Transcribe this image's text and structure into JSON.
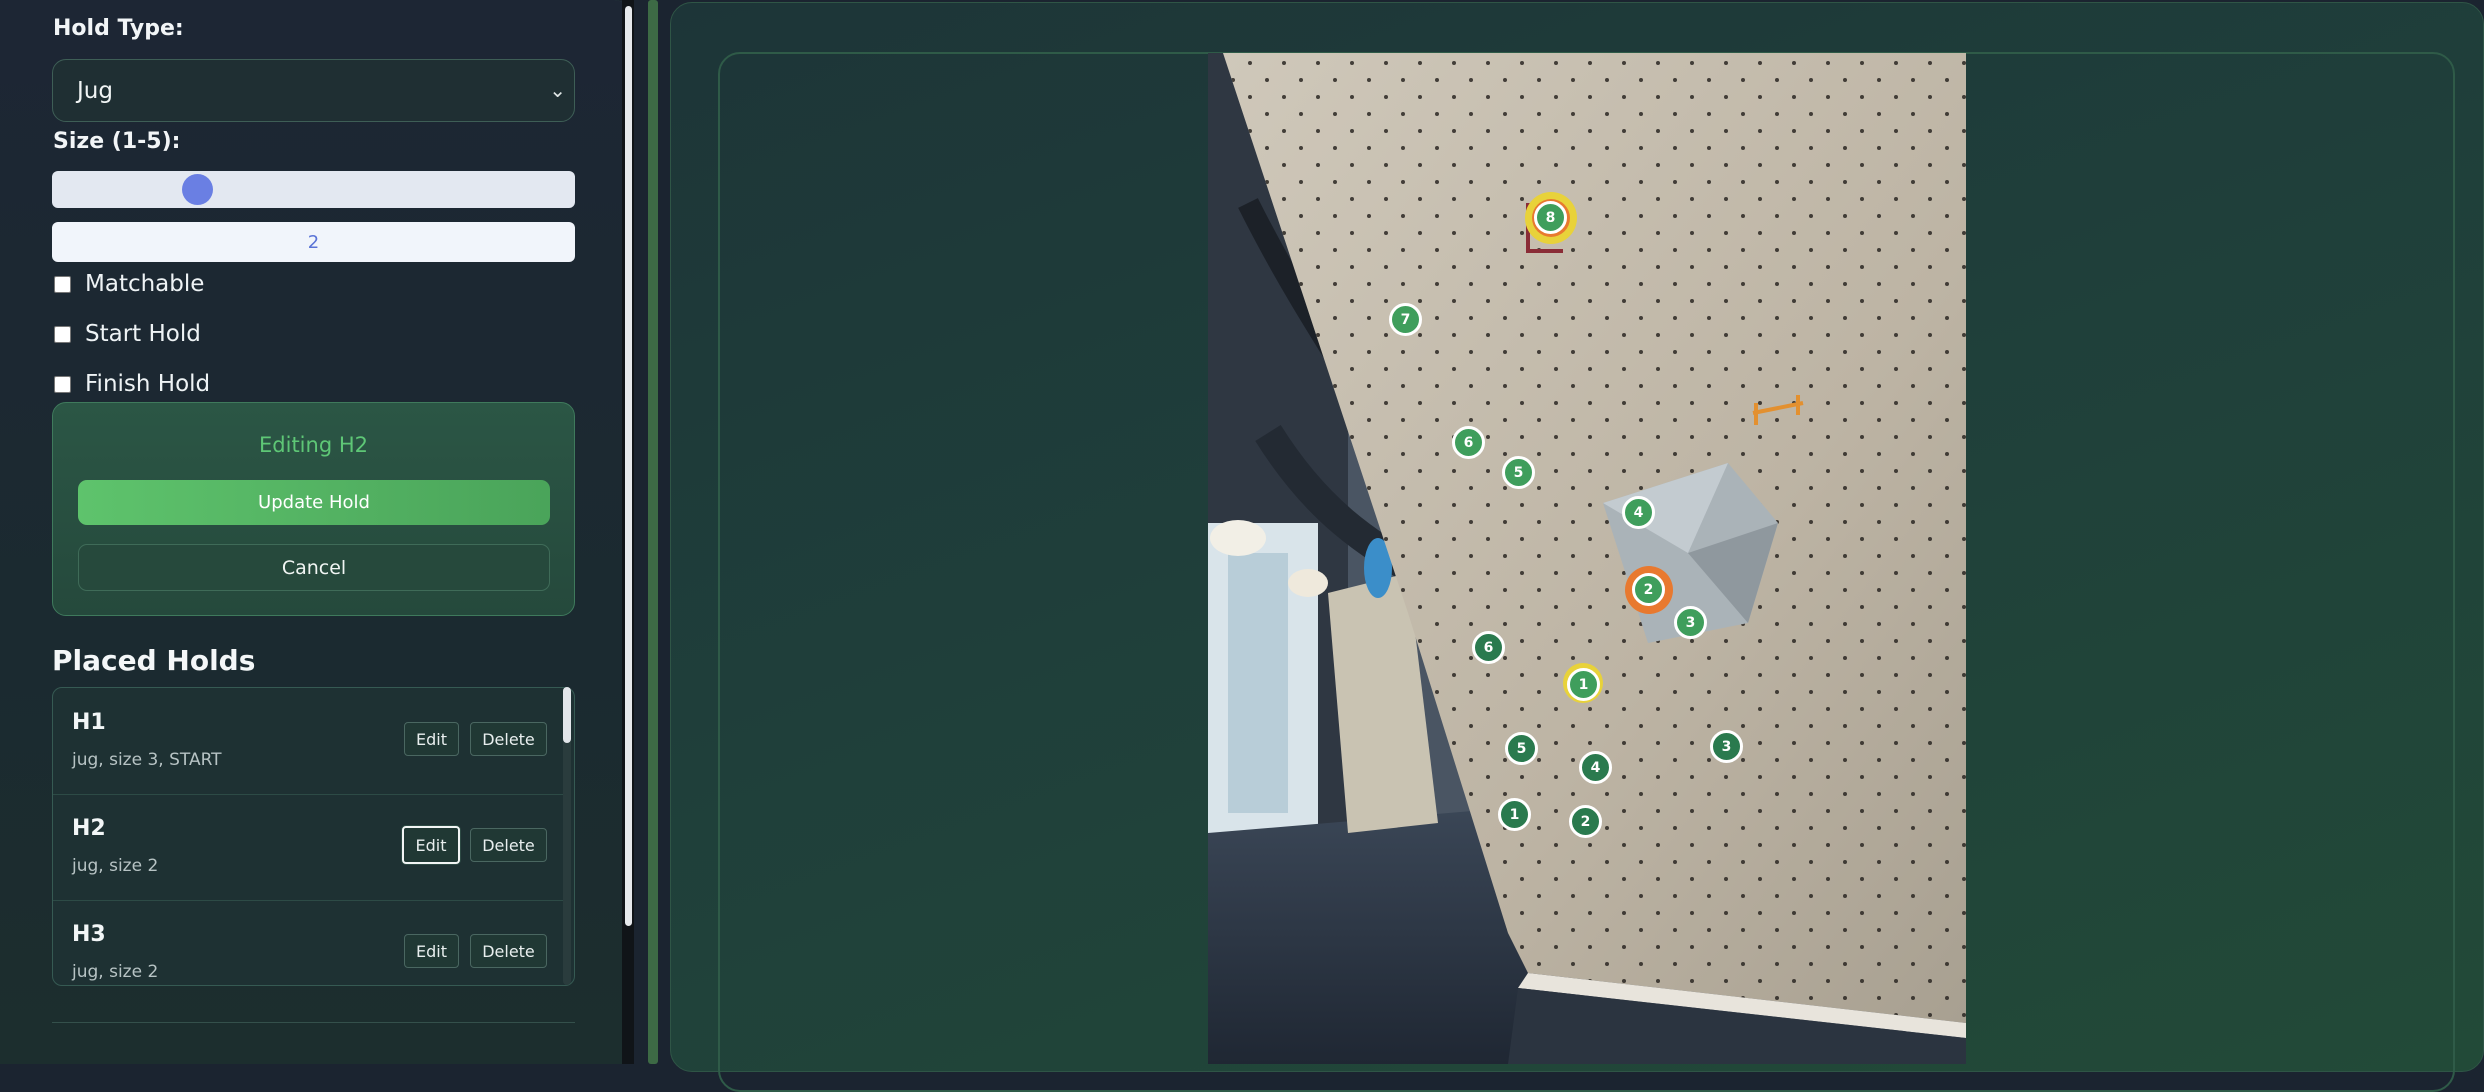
{
  "sidebar": {
    "hold_type_label": "Hold Type:",
    "hold_type_value": "Jug",
    "size_label": "Size (1-5):",
    "size_value": "2",
    "size_level": 2,
    "checkboxes": [
      {
        "label": "Matchable",
        "checked": false
      },
      {
        "label": "Start Hold",
        "checked": false
      },
      {
        "label": "Finish Hold",
        "checked": false
      }
    ],
    "edit_panel": {
      "title": "Editing H2",
      "update_label": "Update Hold",
      "cancel_label": "Cancel"
    },
    "placed_title": "Placed Holds",
    "holds": [
      {
        "name": "H1",
        "desc": "jug, size 3, START",
        "edit": "Edit",
        "delete": "Delete"
      },
      {
        "name": "H2",
        "desc": "jug, size 2",
        "edit": "Edit",
        "delete": "Delete"
      },
      {
        "name": "H3",
        "desc": "jug, size 2",
        "edit": "Edit",
        "delete": "Delete"
      }
    ]
  },
  "wall_markers": [
    "8",
    "7",
    "6",
    "5",
    "4",
    "2",
    "3",
    "6",
    "1",
    "5",
    "4",
    "3",
    "1",
    "2"
  ],
  "colors": {
    "accent_green": "#5ec36c",
    "marker_green": "#3f9e5c",
    "highlight_orange": "#e8792f",
    "highlight_yellow": "#e8d23a",
    "slider_thumb": "#6a7fe3"
  }
}
